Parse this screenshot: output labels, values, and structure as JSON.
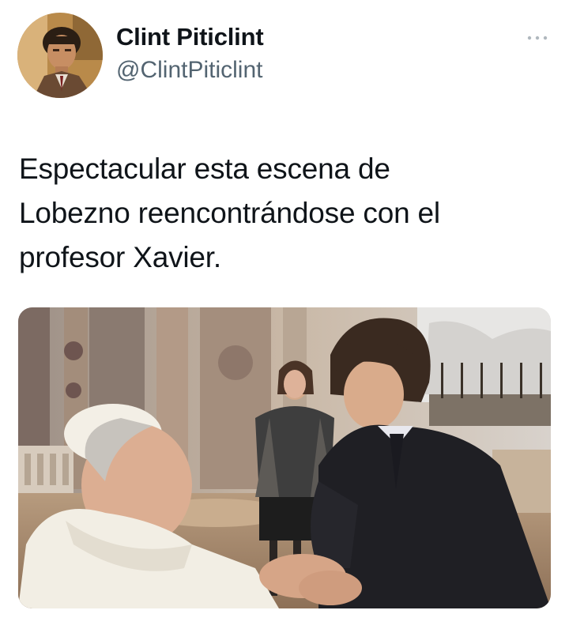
{
  "tweet": {
    "author": {
      "display_name": "Clint Piticlint",
      "handle": "@ClintPiticlint",
      "avatar_icon": "profile-photo-avatar"
    },
    "more_icon": "more-horizontal-icon",
    "text": "Espectacular esta escena de\nLobezno reencontrándose con el\nprofesor Xavier.",
    "media": {
      "kind": "photo",
      "icon": "attached-photo"
    }
  },
  "colors": {
    "text_primary": "#0f1419",
    "text_secondary": "#536471",
    "background": "#ffffff"
  }
}
